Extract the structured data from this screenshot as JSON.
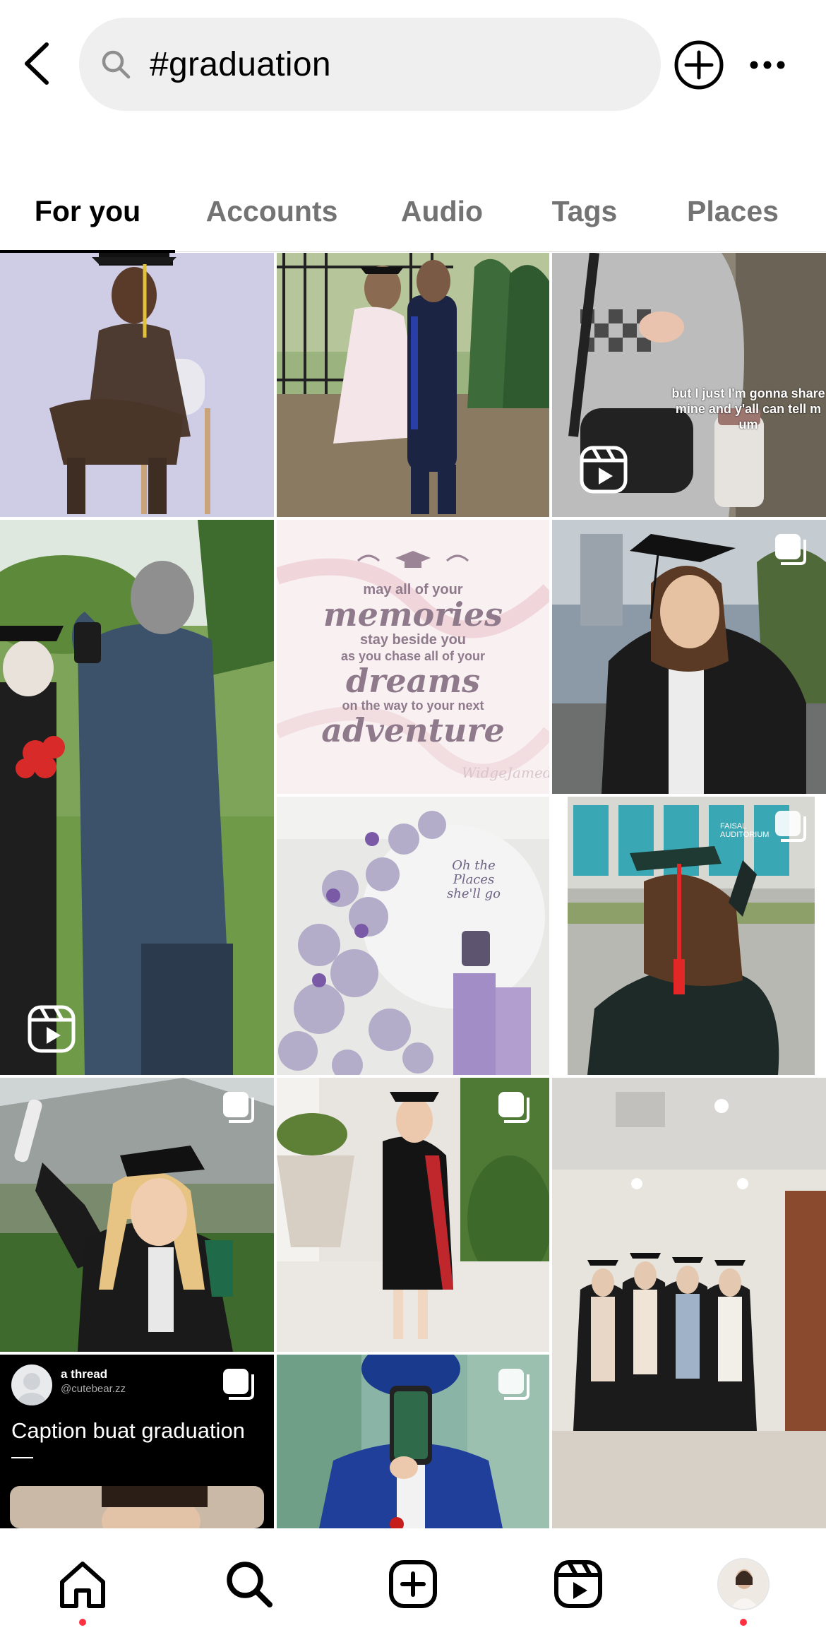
{
  "header": {
    "search_value": "#graduation",
    "back_icon": "chevron-left-icon",
    "search_icon": "search-icon",
    "create_icon": "plus-circle-icon",
    "more_icon": "more-horizontal-icon"
  },
  "tabs": [
    {
      "label": "For you",
      "active": true
    },
    {
      "label": "Accounts",
      "active": false
    },
    {
      "label": "Audio",
      "active": false
    },
    {
      "label": "Tags",
      "active": false
    },
    {
      "label": "Places",
      "active": false
    }
  ],
  "grid": {
    "tiles": [
      {
        "name": "graduate-portrait-chair",
        "badge": "none"
      },
      {
        "name": "couple-graduation-photo",
        "badge": "none"
      },
      {
        "name": "reel-car-caption",
        "badge": "reel-icon",
        "caption": "but I just I'm gonna share mine and y'all can tell m um"
      },
      {
        "name": "man-photographing-graduate",
        "badge": "reel-icon"
      },
      {
        "name": "memories-quote-card",
        "badge": "none",
        "quote": {
          "line1": "may all of your",
          "line2": "memories",
          "line3": "stay beside you",
          "line4": "as you chase all of your",
          "line5": "dreams",
          "line6": "on the way to your next",
          "line7": "adventure",
          "signature": "WidgeJamedi"
        }
      },
      {
        "name": "graduate-holding-tassel",
        "badge": "carousel-icon"
      },
      {
        "name": "balloon-decoration",
        "badge": "none",
        "sign": "Oh the Places she'll go"
      },
      {
        "name": "graduate-back-view",
        "badge": "carousel-icon",
        "building_sign": "FAISAL AUDITORIUM"
      },
      {
        "name": "graduate-holding-diploma",
        "badge": "carousel-icon"
      },
      {
        "name": "graduate-garden-pose",
        "badge": "carousel-icon"
      },
      {
        "name": "four-graduates-hallway",
        "badge": "none"
      },
      {
        "name": "thread-post-card",
        "badge": "carousel-icon",
        "thread": {
          "title": "a thread",
          "handle": "@cutebear.zz",
          "caption": "Caption buat graduation",
          "dash": "—"
        }
      },
      {
        "name": "graduate-showing-phone",
        "badge": "carousel-icon"
      }
    ]
  },
  "bottom_nav": [
    {
      "icon": "home-icon",
      "active": true,
      "dot": true
    },
    {
      "icon": "search-icon",
      "active": false,
      "dot": false
    },
    {
      "icon": "create-icon",
      "active": false,
      "dot": false
    },
    {
      "icon": "reels-icon",
      "active": false,
      "dot": false
    },
    {
      "icon": "profile-avatar",
      "active": false,
      "dot": true
    }
  ],
  "colors": {
    "notification_dot": "#ff3040",
    "tab_inactive": "#737373",
    "search_bg": "#efeff0"
  }
}
